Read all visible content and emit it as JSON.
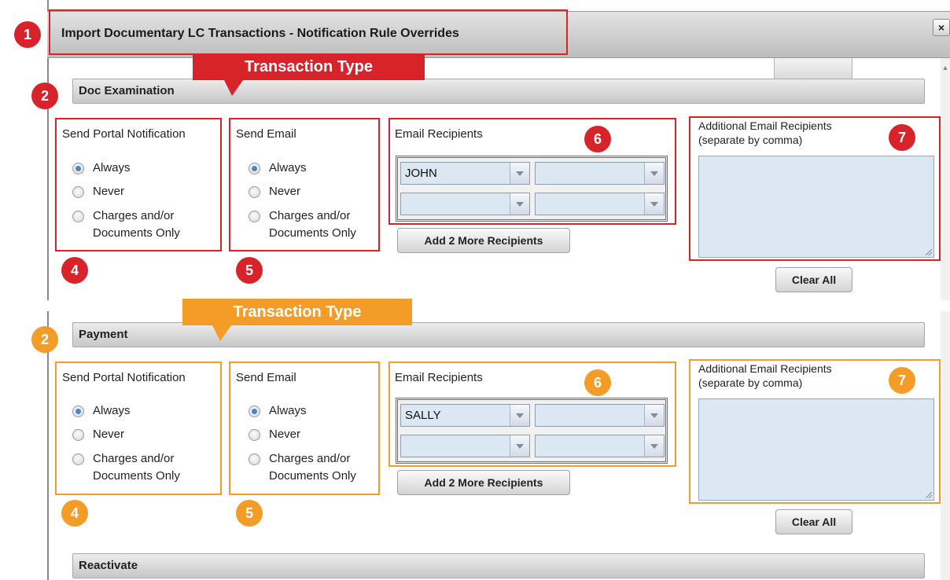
{
  "window": {
    "title": "Import Documentary LC Transactions - Notification Rule Overrides",
    "close_glyph": "×"
  },
  "annotations": {
    "callout_text": "Transaction Type",
    "numbers": {
      "n1": "1",
      "n2": "2",
      "n4": "4",
      "n5": "5",
      "n6": "6",
      "n7": "7"
    },
    "colors": {
      "first_section": "#d8232a",
      "second_section": "#f39c27"
    }
  },
  "sections": [
    {
      "name": "Doc Examination",
      "portal": {
        "title": "Send Portal Notification",
        "options": [
          "Always",
          "Never",
          "Charges and/or",
          "Documents Only"
        ],
        "selected": "Always"
      },
      "email": {
        "title": "Send Email",
        "options": [
          "Always",
          "Never",
          "Charges and/or",
          "Documents Only"
        ],
        "selected": "Always"
      },
      "recipients": {
        "title": "Email Recipients",
        "values": [
          "JOHN",
          "",
          "",
          ""
        ]
      },
      "add_button": "Add 2 More Recipients",
      "additional": {
        "title_line1": "Additional Email Recipients",
        "title_line2": "(separate by comma)",
        "value": ""
      },
      "clear_button": "Clear All"
    },
    {
      "name": "Payment",
      "portal": {
        "title": "Send Portal Notification",
        "options": [
          "Always",
          "Never",
          "Charges and/or",
          "Documents Only"
        ],
        "selected": "Always"
      },
      "email": {
        "title": "Send Email",
        "options": [
          "Always",
          "Never",
          "Charges and/or",
          "Documents Only"
        ],
        "selected": "Always"
      },
      "recipients": {
        "title": "Email Recipients",
        "values": [
          "SALLY",
          "",
          "",
          ""
        ]
      },
      "add_button": "Add 2 More Recipients",
      "additional": {
        "title_line1": "Additional Email Recipients",
        "title_line2": "(separate by comma)",
        "value": ""
      },
      "clear_button": "Clear All"
    },
    {
      "name": "Reactivate"
    }
  ],
  "icons": {
    "radio": "radio-button-icon",
    "dropdown": "chevron-down-icon",
    "resize": "resize-grip-icon",
    "close": "close-icon"
  }
}
